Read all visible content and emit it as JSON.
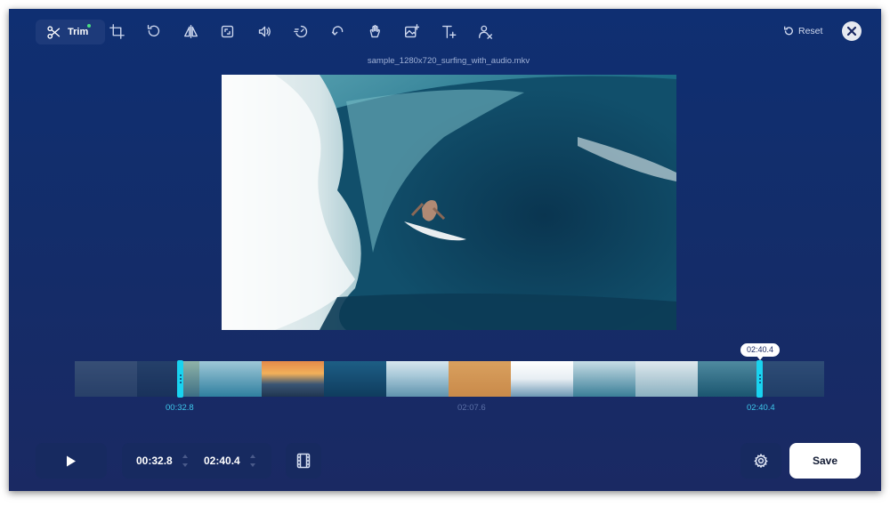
{
  "toolbar": {
    "trim_label": "Trim",
    "tools": [
      "trim-icon",
      "crop-icon",
      "rotate-icon",
      "flip-icon",
      "resize-icon",
      "volume-icon",
      "speed-icon",
      "loop-icon",
      "stabilize-icon",
      "add-image-icon",
      "add-text-icon",
      "remove-watermark-icon"
    ],
    "reset_label": "Reset"
  },
  "video": {
    "filename": "sample_1280x720_surfing_with_audio.mkv"
  },
  "timeline": {
    "start_time": "00:32.8",
    "mid_time": "02:07.6",
    "end_time": "02:40.4",
    "end_bubble": "02:40.4"
  },
  "controls": {
    "start_value": "00:32.8",
    "end_value": "02:40.4",
    "save_label": "Save"
  },
  "colors": {
    "accent": "#19d3f0",
    "background": "#132d6a",
    "active_dot": "#4ade80"
  }
}
